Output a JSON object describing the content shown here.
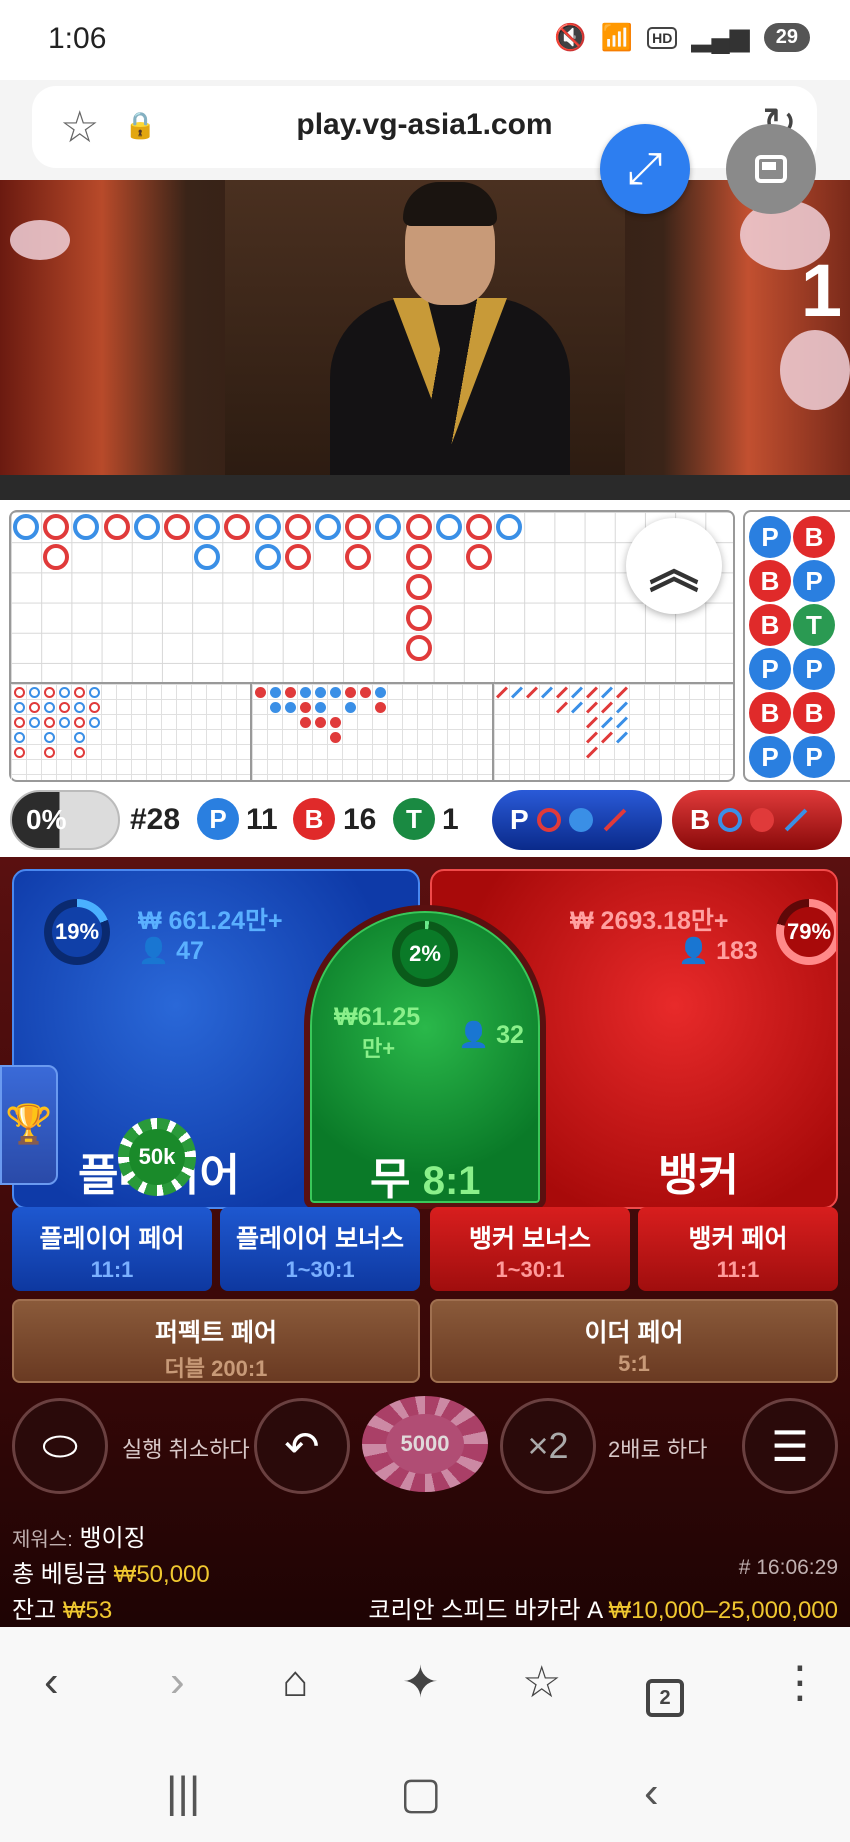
{
  "status": {
    "time": "1:06",
    "battery": "29",
    "hd": "HD"
  },
  "browser": {
    "url": "play.vg-asia1.com",
    "tab_count": "2"
  },
  "video": {
    "round_number": "1"
  },
  "stats": {
    "streak_pct": "0%",
    "shoe": "#28",
    "player_letter": "P",
    "player_count": "11",
    "banker_letter": "B",
    "banker_count": "16",
    "tie_letter": "T",
    "tie_count": "1",
    "predict_player": "P",
    "predict_banker": "B"
  },
  "side_bead": [
    [
      "P",
      "B"
    ],
    [
      "B",
      "P"
    ],
    [
      "B",
      "T"
    ],
    [
      "P",
      "P"
    ],
    [
      "B",
      "B"
    ],
    [
      "P",
      "P"
    ]
  ],
  "bets": {
    "player": {
      "label": "플레이어",
      "amount": "₩ 661.24만+",
      "users": "47",
      "pct": "19%"
    },
    "banker": {
      "label": "뱅커",
      "amount": "₩ 2693.18만+",
      "users": "183",
      "pct": "79%"
    },
    "tie": {
      "label": "무",
      "odds": "8:1",
      "currency": "₩",
      "amount": "61.25",
      "amount_unit": "만+",
      "users": "32",
      "pct": "2%"
    },
    "chip_on_player": "50k"
  },
  "side_bets": [
    {
      "label": "플레이어 페어",
      "odds": "11:1"
    },
    {
      "label": "플레이어 보너스",
      "odds": "1~30:1"
    },
    {
      "label": "뱅커 보너스",
      "odds": "1~30:1"
    },
    {
      "label": "뱅커 페어",
      "odds": "11:1"
    },
    {
      "label": "퍼펙트 페어",
      "odds": "더블 200:1"
    },
    {
      "label": "이더 페어",
      "odds": "5:1"
    }
  ],
  "controls": {
    "undo_label": "실행 취소하다",
    "chip_value": "5000",
    "double_symbol": "×2",
    "double_label": "2배로 하다"
  },
  "info": {
    "user_label": "제워스:",
    "user_name": "뱅이징",
    "total_bet_label": "총 베팅금",
    "total_bet": "₩50,000",
    "balance_label": "잔고",
    "balance": "₩53",
    "timestamp": "# 16:06:29",
    "table_name": "코리안 스피드 바카라 A",
    "limits": "₩10,000–25,000,000"
  }
}
